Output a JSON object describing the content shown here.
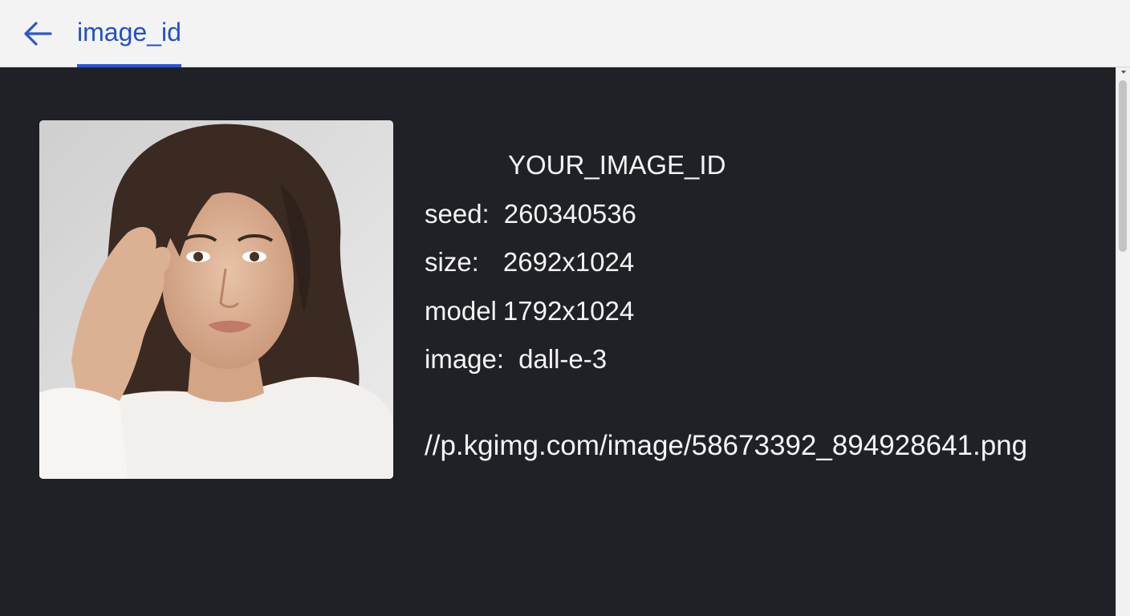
{
  "header": {
    "back_icon": "arrow-left-icon",
    "tab_label": "image_id",
    "accent_color": "#2450c8"
  },
  "details": {
    "image_id": "YOUR_IMAGE_ID",
    "seed_label": "seed:",
    "seed_value": "260340536",
    "size_label": "size:",
    "size_value": "2692x1024",
    "model_label": "model",
    "model_value": "1792x1024",
    "image_label": "image:",
    "image_value": "dall-e-3",
    "url": "//p.kgimg.com/image/58673392_894928641.png"
  }
}
